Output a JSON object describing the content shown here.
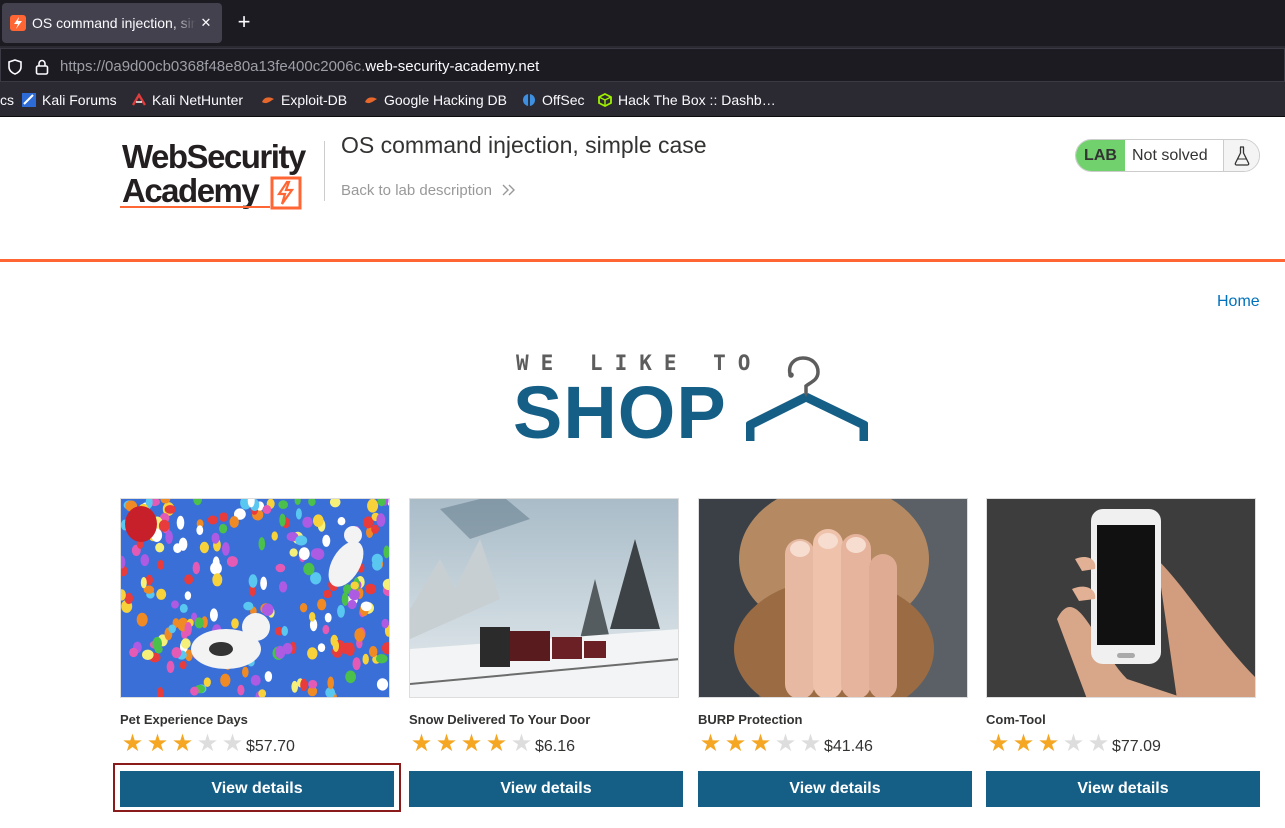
{
  "browser": {
    "tab_title": "OS command injection, simple case",
    "url_prefix": "https://0a9d00cb0368f48e80a13fe400c2006c.",
    "url_domain": "web-security-academy.net",
    "bookmarks": [
      {
        "label": "cs",
        "icon": "none"
      },
      {
        "label": "Kali Forums",
        "icon": "kali-forums-icon"
      },
      {
        "label": "Kali NetHunter",
        "icon": "kali-nethunter-icon"
      },
      {
        "label": "Exploit-DB",
        "icon": "exploit-db-icon"
      },
      {
        "label": "Google Hacking DB",
        "icon": "ghdb-icon"
      },
      {
        "label": "OffSec",
        "icon": "offsec-icon"
      },
      {
        "label": "Hack The Box :: Dashb…",
        "icon": "htb-icon"
      }
    ]
  },
  "lab": {
    "logo_line1": "WebSecurity",
    "logo_line2": "Academy",
    "title": "OS command injection, simple case",
    "back_link": "Back to lab description",
    "status_badge": "LAB",
    "status_text": "Not solved"
  },
  "page": {
    "nav_home": "Home",
    "banner_small": "WE LIKE TO",
    "banner_big": "SHOP"
  },
  "products": [
    {
      "name": "Pet Experience Days",
      "price": "$57.70",
      "rating": 3,
      "button": "View details"
    },
    {
      "name": "Snow Delivered To Your Door",
      "price": "$6.16",
      "rating": 4,
      "button": "View details"
    },
    {
      "name": "BURP Protection",
      "price": "$41.46",
      "rating": 3,
      "button": "View details"
    },
    {
      "name": "Com-Tool",
      "price": "$77.09",
      "rating": 3,
      "button": "View details"
    }
  ],
  "colors": {
    "accent": "#ff6633",
    "button": "#155f87",
    "lab_badge": "#70d16d",
    "star_on": "#f5a623",
    "star_off": "#dddddd"
  }
}
